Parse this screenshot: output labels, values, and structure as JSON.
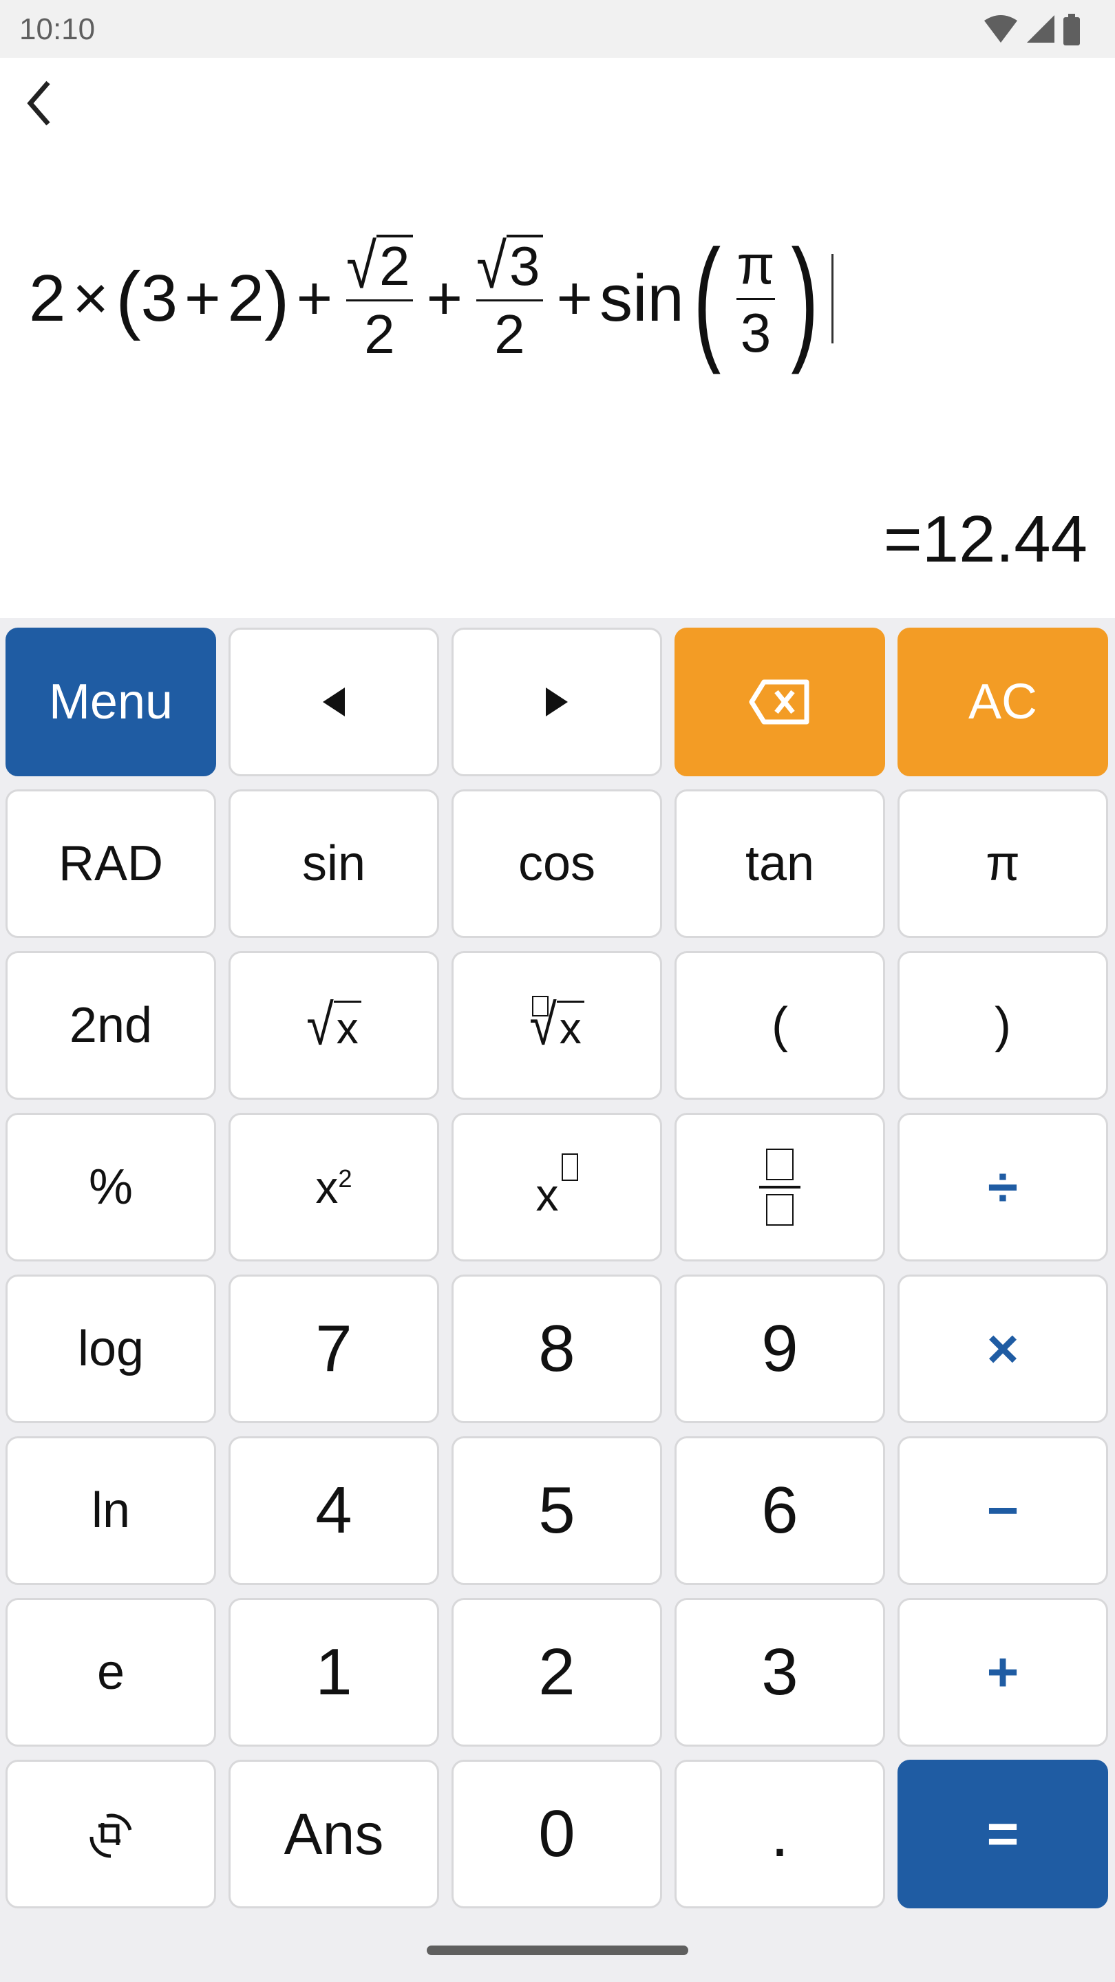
{
  "status_bar": {
    "time": "10:10",
    "icons": [
      "wifi-icon",
      "signal-icon",
      "battery-icon"
    ]
  },
  "display": {
    "back_icon": "chevron-left-icon",
    "expression": {
      "t1": "2",
      "times": "×",
      "lparen": "(",
      "t2": "3",
      "plus_inner": "+",
      "t3": "2",
      "rparen": ")",
      "plus1": "+",
      "frac1_num_radicand": "2",
      "frac1_den": "2",
      "plus2": "+",
      "frac2_num_radicand": "3",
      "frac2_den": "2",
      "plus3": "+",
      "func": "sin",
      "frac3_num": "π",
      "frac3_den": "3",
      "func_lparen": "(",
      "func_rparen": ")"
    },
    "result": "=12.44"
  },
  "keypad": {
    "row1": {
      "menu": "Menu",
      "left": "◀",
      "right": "▶",
      "backspace": "⌫",
      "ac": "AC"
    },
    "row2": {
      "rad": "RAD",
      "sin": "sin",
      "cos": "cos",
      "tan": "tan",
      "pi": "π"
    },
    "row3": {
      "second": "2nd",
      "sqrt_x": "x",
      "nthroot_x": "x",
      "lparen": "(",
      "rparen": ")"
    },
    "row4": {
      "percent": "%",
      "square_base": "x",
      "square_exp": "2",
      "power_base": "x",
      "fraction": "",
      "divide": "÷"
    },
    "row5": {
      "log": "log",
      "seven": "7",
      "eight": "8",
      "nine": "9",
      "multiply": "×"
    },
    "row6": {
      "ln": "ln",
      "four": "4",
      "five": "5",
      "six": "6",
      "minus": "−"
    },
    "row7": {
      "e": "e",
      "one": "1",
      "two": "2",
      "three": "3",
      "plus": "+"
    },
    "row8": {
      "rotate_icon": "rotate-icon",
      "ans": "Ans",
      "zero": "0",
      "dot": ".",
      "equals": "="
    }
  },
  "colors": {
    "primary_blue": "#1f5ca3",
    "accent_orange": "#f39c25",
    "keypad_bg": "#eeeef1"
  }
}
